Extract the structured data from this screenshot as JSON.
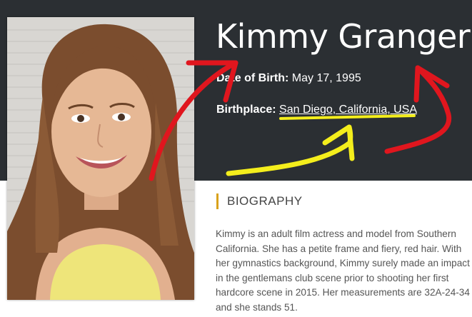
{
  "profile": {
    "name": "Kimmy Granger",
    "dob_label": "Date of Birth:",
    "dob_value": "May 17, 1995",
    "birthplace_label": "Birthplace:",
    "birthplace_value": "San Diego, California, USA"
  },
  "biography": {
    "heading": "BIOGRAPHY",
    "text": "Kimmy is an adult film actress and model from Southern California. She has a petite frame and fiery, red hair. With her gymnastics background, Kimmy surely made an impact in the gentlemans club scene prior to shooting her first hardcore scene in 2015. Her measurements are 32A-24-34 and she stands 51."
  },
  "colors": {
    "header_bg": "#2b2f33",
    "accent": "#d9a21b",
    "annotation_red": "#e0161e",
    "annotation_yellow": "#f4ee1c"
  }
}
